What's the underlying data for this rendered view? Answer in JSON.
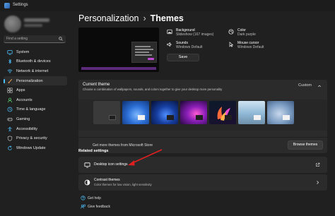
{
  "window": {
    "title": "Settings"
  },
  "search": {
    "placeholder": "Find a setting"
  },
  "sidebar": {
    "items": [
      {
        "label": "System",
        "icon": "monitor-icon",
        "color": "#4cc2ff"
      },
      {
        "label": "Bluetooth & devices",
        "icon": "bluetooth-icon",
        "color": "#4cc2ff"
      },
      {
        "label": "Network & internet",
        "icon": "wifi-icon",
        "color": "#4cc2ff"
      },
      {
        "label": "Personalization",
        "icon": "brush-icon",
        "color": "#f0a35b",
        "active": true
      },
      {
        "label": "Apps",
        "icon": "apps-icon",
        "color": "#b7b7b7"
      },
      {
        "label": "Accounts",
        "icon": "person-icon",
        "color": "#56c96b"
      },
      {
        "label": "Time & language",
        "icon": "clock-icon",
        "color": "#4cc2ff"
      },
      {
        "label": "Gaming",
        "icon": "gamepad-icon",
        "color": "#b7b7b7"
      },
      {
        "label": "Accessibility",
        "icon": "accessibility-icon",
        "color": "#4cc2ff"
      },
      {
        "label": "Privacy & security",
        "icon": "shield-icon",
        "color": "#b7b7b7"
      },
      {
        "label": "Windows Update",
        "icon": "update-icon",
        "color": "#4cc2ff"
      }
    ]
  },
  "header": {
    "parent": "Personalization",
    "separator": "›",
    "current": "Themes"
  },
  "theme_props": {
    "background": {
      "label": "Background",
      "value": "Slideshow (167 images)"
    },
    "color": {
      "label": "Color",
      "value": "Dark purple"
    },
    "sounds": {
      "label": "Sounds",
      "value": "Windows Default"
    },
    "cursor": {
      "label": "Mouse cursor",
      "value": "Windows Default"
    },
    "save_label": "Save"
  },
  "current_theme": {
    "title": "Current theme",
    "subtitle": "Choose a combination of wallpapers, sounds, and colors together to give your desktop more personality",
    "value": "Custom"
  },
  "store_row": {
    "label": "Get more themes from Microsoft Store",
    "button": "Browse themes"
  },
  "related": {
    "heading": "Related settings",
    "desktop_icons": {
      "label": "Desktop icon settings"
    },
    "contrast": {
      "label": "Contrast themes",
      "sub": "Color themes for low vision, light sensitivity"
    }
  },
  "help": {
    "get_help": "Get help",
    "feedback": "Give feedback"
  },
  "colors": {
    "accent": "#4cc2ff",
    "highlight_purple": "#c04ad6",
    "arrow_red": "#e02020"
  }
}
